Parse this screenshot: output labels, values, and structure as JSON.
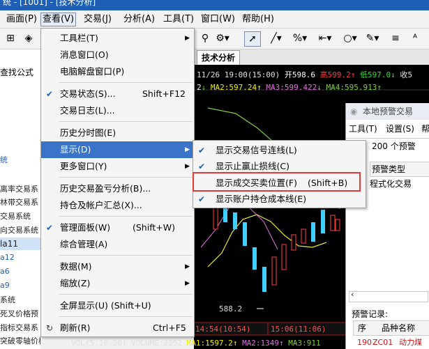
{
  "window": {
    "title": "统 - [1001] - [技术分析]"
  },
  "menubar": {
    "items": [
      {
        "label": "画面(P)"
      },
      {
        "label": "查看(V)"
      },
      {
        "label": "交易(J)"
      },
      {
        "label": "分析(A)"
      },
      {
        "label": "工具(T)"
      },
      {
        "label": "窗口(W)"
      },
      {
        "label": "帮助(H)"
      }
    ]
  },
  "left_panel": {
    "search_label": "查找公式",
    "items": [
      "统",
      "离率交易系",
      "林带交易系",
      "交易系统",
      "向交易系统",
      "la11",
      "a12",
      "a6",
      "a9",
      "系统",
      "死叉价格预",
      "指标交易系",
      "突破零轴价格"
    ]
  },
  "chart": {
    "tab_label": "技术分析",
    "line1": {
      "date": "11/26 19:00(15:00)",
      "open": "开598.6",
      "high": "高599.2",
      "low": "低597.0",
      "extra": "收5"
    },
    "line2": {
      "ma2_label": "MA2:597.24",
      "ma3_label": "MA3:599.422",
      "ma4_label": "MA4:595.913",
      "prefix": "2"
    },
    "low_label": "588.2",
    "time_left": "14:54(10:54)",
    "time_right": "15:06(11:06)",
    "vol_line": "VOL(5,10,20) VOLUME:2252",
    "vol_ma1": "MA1:1597.2",
    "vol_ma2": "MA2:1349",
    "vol_ma3": "MA3:911"
  },
  "alert_window": {
    "title": "本地预警交易",
    "menu_tools": "工具(T)",
    "menu_settings": "设置(S)",
    "menu_help": "帮",
    "count_label": "200 个预警",
    "col_type": "预警类型",
    "row_type": "程式化交易",
    "records_label": "预警记录:",
    "rec_col_seq": "序",
    "rec_col_name": "品种名称",
    "rec_seq": "190",
    "rec_code": "ZC01",
    "rec_name": "动力煤"
  },
  "view_menu": {
    "items": [
      {
        "label": "工具栏(T)",
        "submenu": true
      },
      {
        "label": "消息窗口(O)"
      },
      {
        "label": "电脑解盘窗口(P)"
      },
      {
        "label": "交易状态(S)...",
        "shortcut": "Shift+F12",
        "checked": true
      },
      {
        "label": "交易日志(L)..."
      },
      {
        "label": "历史分时图(E)"
      },
      {
        "label": "显示(D)",
        "submenu": true,
        "highlighted": true
      },
      {
        "label": "更多窗口(Y)",
        "submenu": true
      },
      {
        "label": "历史交易盈亏分析(B)..."
      },
      {
        "label": "持仓及帐户汇总(X)..."
      },
      {
        "label": "管理面板(W)",
        "shortcut": "(Shift+W)",
        "checked": true
      },
      {
        "label": "综合管理(A)"
      },
      {
        "label": "数据(M)",
        "submenu": true
      },
      {
        "label": "缩放(Z)",
        "submenu": true
      },
      {
        "label": "全屏显示(U) (Shift+U)"
      },
      {
        "label": "刷新(R)",
        "shortcut": "Ctrl+F5"
      }
    ]
  },
  "display_submenu": {
    "items": [
      {
        "label": "显示交易信号连线(L)",
        "checked": true
      },
      {
        "label": "显示止赢止损线(C)",
        "checked": true
      },
      {
        "label": "显示成交买卖位置(F)",
        "shortcut": "(Shift+B)",
        "checked": false
      },
      {
        "label": "显示账户持仓成本线(E)",
        "checked": true
      }
    ]
  },
  "colors": {
    "highlight": "#3a74c8",
    "red_box": "#e03a3a",
    "check": "#1e5fb5"
  }
}
